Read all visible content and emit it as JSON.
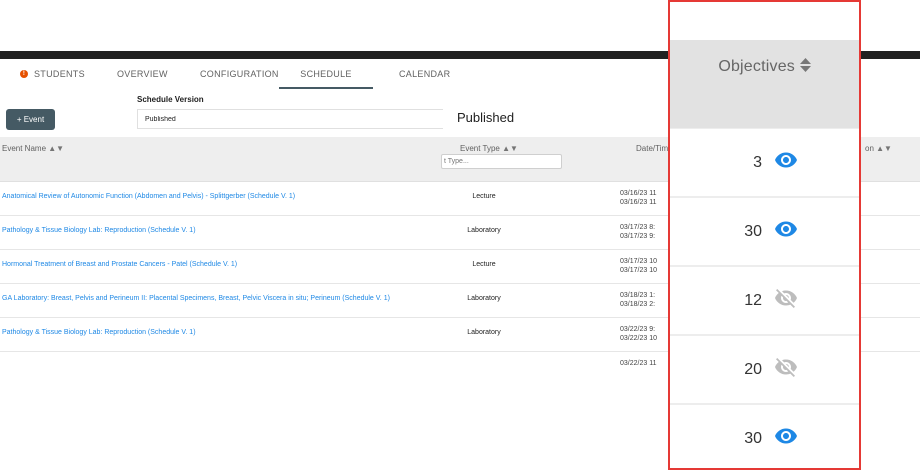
{
  "tabs": [
    {
      "label": "STUDENTS"
    },
    {
      "label": "OVERVIEW"
    },
    {
      "label": "CONFIGURATION"
    },
    {
      "label": "SCHEDULE",
      "active": true
    },
    {
      "label": "CALENDAR"
    }
  ],
  "toolbar": {
    "add_event_label": "+ Event",
    "schedule_version_label": "Schedule Version",
    "schedule_version_value": "Published",
    "published_heading": "Published"
  },
  "table": {
    "columns": {
      "event_name": "Event Name",
      "event_type": "Event Type",
      "event_type_filter_placeholder": "t Type...",
      "date_time": "Date/Tim",
      "location_partial": "on"
    },
    "rows": [
      {
        "name": "Anatomical Review of Autonomic Function (Abdomen and Pelvis) - Splittgerber (Schedule V. 1)",
        "type": "Lecture",
        "date_line1": "03/16/23 11",
        "date_line2": "03/16/23 11"
      },
      {
        "name": "Pathology & Tissue Biology Lab: Reproduction (Schedule V. 1)",
        "type": "Laboratory",
        "date_line1": "03/17/23 8:",
        "date_line2": "03/17/23 9:"
      },
      {
        "name": "Hormonal Treatment of Breast and Prostate Cancers - Patel (Schedule V. 1)",
        "type": "Lecture",
        "date_line1": "03/17/23 10",
        "date_line2": "03/17/23 10"
      },
      {
        "name": "GA Laboratory: Breast, Pelvis and Perineum II: Placental Specimens, Breast, Pelvic Viscera in situ; Perineum (Schedule V. 1)",
        "type": "Laboratory",
        "date_line1": "03/18/23 1:",
        "date_line2": "03/18/23 2:"
      },
      {
        "name": "Pathology & Tissue Biology Lab: Reproduction (Schedule V. 1)",
        "type": "Laboratory",
        "date_line1": "03/22/23 9:",
        "date_line2": "03/22/23 10"
      }
    ],
    "partial_row_date": "03/22/23 11"
  },
  "objectives_panel": {
    "title": "Objectives",
    "highlight_color": "#e53935",
    "visible_icon_color": "#1e88e5",
    "hidden_icon_color": "#bdbdbd",
    "cells": [
      {
        "count": "3",
        "icon": "eye-icon",
        "visible": true
      },
      {
        "count": "30",
        "icon": "eye-icon",
        "visible": true
      },
      {
        "count": "12",
        "icon": "eye-off-icon",
        "visible": false
      },
      {
        "count": "20",
        "icon": "eye-off-icon",
        "visible": false
      },
      {
        "count": "30",
        "icon": "eye-icon",
        "visible": true
      }
    ]
  }
}
